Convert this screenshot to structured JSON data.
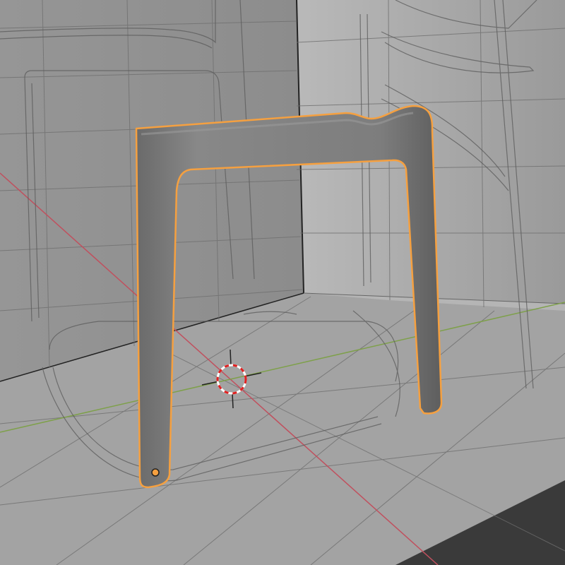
{
  "viewport": {
    "view": "3d-perspective",
    "background_color": "#8f8f8f",
    "floor_color": "#a4a4a4",
    "grid_color": "#6e6e6e",
    "x_axis_color": "#c0505e",
    "y_axis_color": "#7ea04a"
  },
  "selected_object": {
    "name_hint": "chair-leg-frame",
    "selection_outline_color": "#f5a040",
    "mesh_color": "#7c7c7c",
    "origin_point_color": "#f5a040"
  },
  "cursor": {
    "type": "3d-cursor",
    "ring_colors": [
      "#e02020",
      "#ffffff"
    ]
  },
  "reference_geometry": {
    "type": "wireframe-chair-references",
    "line_color": "#5a5a5a"
  }
}
